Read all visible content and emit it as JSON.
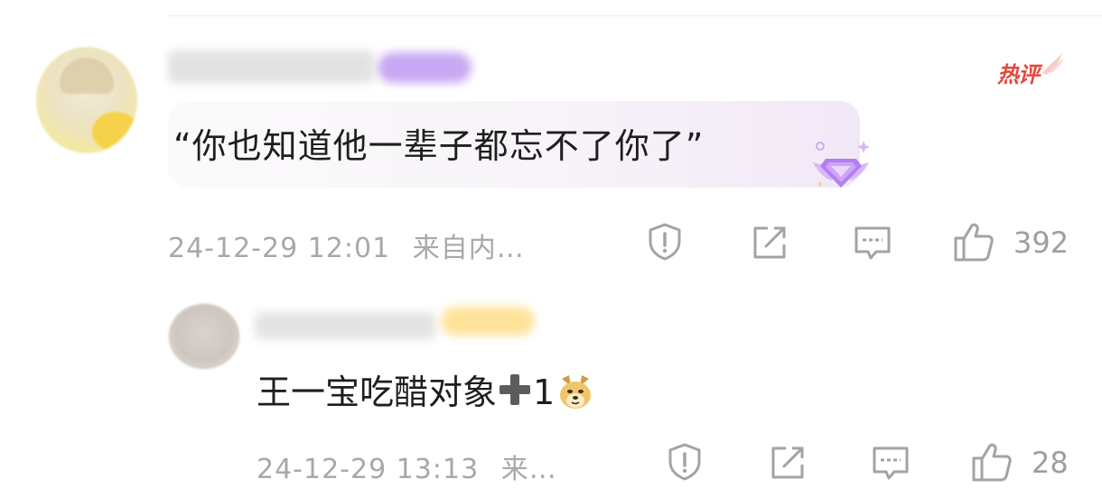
{
  "main_comment": {
    "hot_label": "热评",
    "text": "“你也知道他一辈子都忘不了你了”",
    "timestamp": "24-12-29 12:01",
    "source": "来自内…",
    "like_count": "392"
  },
  "reply": {
    "text": "王一宝吃醋对象",
    "suffix": "1",
    "timestamp": "24-12-29 13:13",
    "source": "来…",
    "like_count": "28"
  },
  "icons": {
    "report": "report-icon",
    "share": "share-icon",
    "comment": "comment-icon",
    "like": "thumbs-up-icon",
    "hot": "hot-tag-icon",
    "gem": "gem-badge-icon",
    "plus": "plus-emoji-icon",
    "doge": "doge-emoji-icon"
  },
  "colors": {
    "hot_red": "#e8453c",
    "meta_gray": "#a8a8a8",
    "gem_purple": "#b37ef2"
  }
}
